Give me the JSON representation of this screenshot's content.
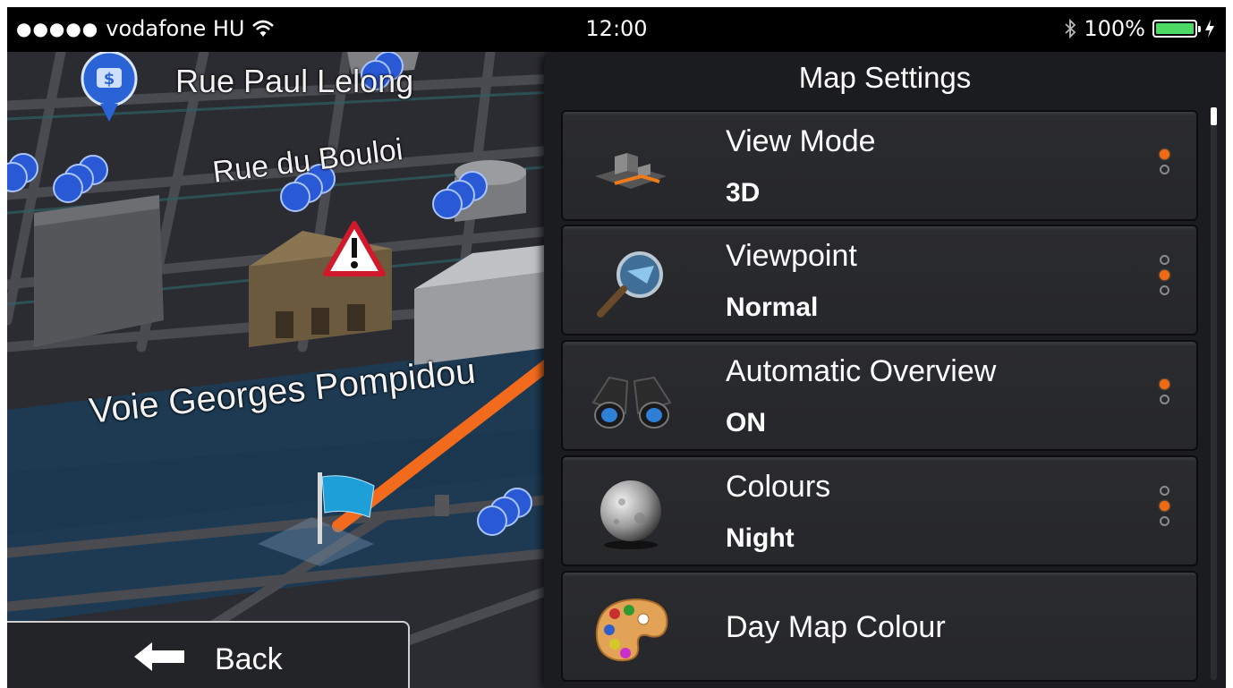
{
  "status_bar": {
    "signal": "●●●●●",
    "carrier": "vodafone HU",
    "time": "12:00",
    "battery_percent": "100%",
    "battery_level": 1.0,
    "battery_color": "#4cd964"
  },
  "map": {
    "streets": [
      "Rue Paul Lelong",
      "Rue du Bouloi",
      "Voie Georges Pompidou"
    ],
    "route_color": "#f26b1d",
    "back_label": "Back"
  },
  "settings": {
    "title": "Map Settings",
    "accent": "#ef6a12",
    "items": [
      {
        "title": "View Mode",
        "value": "3D",
        "icon": "view-mode-3d-icon",
        "options": 2,
        "selected": 0
      },
      {
        "title": "Viewpoint",
        "value": "Normal",
        "icon": "magnifier-icon",
        "options": 3,
        "selected": 1
      },
      {
        "title": "Automatic Overview",
        "value": "ON",
        "icon": "binoculars-icon",
        "options": 2,
        "selected": 0
      },
      {
        "title": "Colours",
        "value": "Night",
        "icon": "moon-icon",
        "options": 3,
        "selected": 1
      },
      {
        "title": "Day Map Colour",
        "value": "",
        "icon": "palette-icon",
        "options": 0,
        "selected": -1
      }
    ]
  }
}
